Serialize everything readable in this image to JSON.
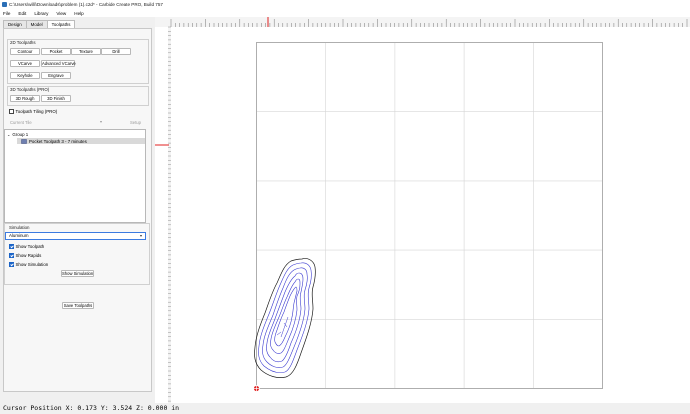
{
  "window": {
    "title": "C:\\Users\\willi\\Downloads\\problem (1).c2d* - Carbide Create PRO, Build 757"
  },
  "menu": [
    "File",
    "Edit",
    "Library",
    "View",
    "Help"
  ],
  "tabs": [
    {
      "label": "Design",
      "active": false
    },
    {
      "label": "Model",
      "active": false
    },
    {
      "label": "Toolpaths",
      "active": true
    }
  ],
  "toolpaths_2d": {
    "title": "2D Toolpaths",
    "buttons": [
      "Contour",
      "Pocket",
      "Texture",
      "Drill",
      "VCarve",
      "Advanced VCarve",
      "Keyhole",
      "Engrave"
    ]
  },
  "toolpaths_3d": {
    "title": "3D Toolpaths (PRO)",
    "buttons": [
      "3D Rough",
      "3D Finish"
    ]
  },
  "tiling": {
    "label": "Toolpath Tiling (PRO)",
    "checked": false,
    "current_tile_label": "Current Tile",
    "setup_label": "Setup"
  },
  "toolpath_list": {
    "group": "Group 1",
    "items": [
      "Pocket Toolpath 3 - 7 minutes"
    ]
  },
  "simulation": {
    "title": "Simulation",
    "material": "Aluminum",
    "options": [
      {
        "label": "Show Toolpath",
        "checked": true
      },
      {
        "label": "Show Rapids",
        "checked": true
      },
      {
        "label": "Show Simulation",
        "checked": true
      }
    ],
    "show_button": "Show Simulation"
  },
  "save_button": "Save Toolpaths",
  "status": {
    "cursor": "Cursor Position X: 0.173 Y: 3.524 Z: 0.000 in"
  },
  "colors": {
    "toolpath": "#3a3ad0",
    "outline": "#1a1a1a",
    "origin": "#e02020",
    "grid": "#d6d6d6"
  }
}
